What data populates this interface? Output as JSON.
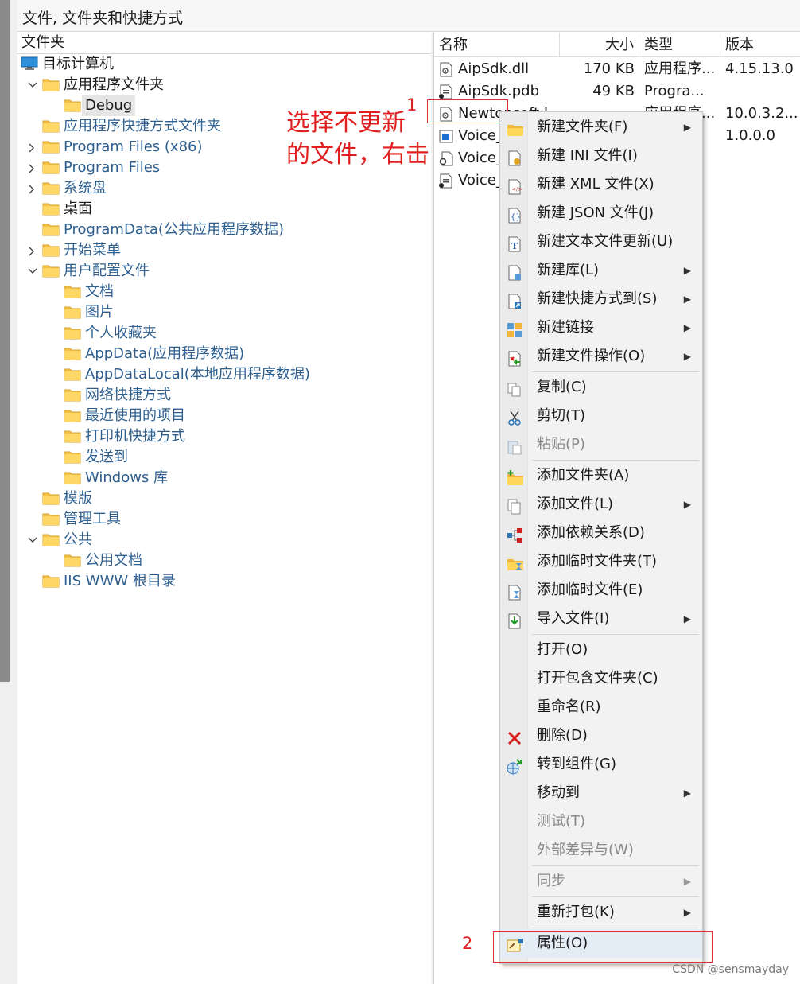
{
  "window": {
    "title": "文件, 文件夹和快捷方式"
  },
  "tree": {
    "header": "文件夹",
    "items": [
      {
        "label": "目标计算机",
        "icon": "monitor-icon",
        "expander": "none",
        "dim": false
      },
      {
        "label": "应用程序文件夹",
        "icon": "folder-icon",
        "expander": "expanded",
        "dim": false
      },
      {
        "label": "Debug",
        "icon": "folder-icon",
        "expander": "none",
        "dim": false,
        "selected": true
      },
      {
        "label": "应用程序快捷方式文件夹",
        "icon": "folder-icon",
        "expander": "none",
        "dim": true
      },
      {
        "label": "Program Files (x86)",
        "icon": "folder-icon",
        "expander": "collapsed",
        "dim": true
      },
      {
        "label": "Program Files",
        "icon": "folder-icon",
        "expander": "collapsed",
        "dim": true
      },
      {
        "label": "系统盘",
        "icon": "folder-icon",
        "expander": "collapsed",
        "dim": true
      },
      {
        "label": "桌面",
        "icon": "folder-icon",
        "expander": "none",
        "dim": false
      },
      {
        "label": "ProgramData(公共应用程序数据)",
        "icon": "folder-icon",
        "expander": "none",
        "dim": true
      },
      {
        "label": "开始菜单",
        "icon": "folder-icon",
        "expander": "collapsed",
        "dim": true
      },
      {
        "label": "用户配置文件",
        "icon": "folder-icon",
        "expander": "expanded",
        "dim": true
      },
      {
        "label": "文档",
        "icon": "folder-icon",
        "expander": "none",
        "dim": true
      },
      {
        "label": "图片",
        "icon": "folder-icon",
        "expander": "none",
        "dim": true
      },
      {
        "label": "个人收藏夹",
        "icon": "folder-icon",
        "expander": "none",
        "dim": true
      },
      {
        "label": "AppData(应用程序数据)",
        "icon": "folder-icon",
        "expander": "none",
        "dim": true
      },
      {
        "label": "AppDataLocal(本地应用程序数据)",
        "icon": "folder-icon",
        "expander": "none",
        "dim": true
      },
      {
        "label": "网络快捷方式",
        "icon": "folder-icon",
        "expander": "none",
        "dim": true
      },
      {
        "label": "最近使用的项目",
        "icon": "folder-icon",
        "expander": "none",
        "dim": true
      },
      {
        "label": "打印机快捷方式",
        "icon": "folder-icon",
        "expander": "none",
        "dim": true
      },
      {
        "label": "发送到",
        "icon": "folder-icon",
        "expander": "none",
        "dim": true
      },
      {
        "label": "Windows 库",
        "icon": "folder-icon",
        "expander": "none",
        "dim": true
      },
      {
        "label": "模版",
        "icon": "folder-icon",
        "expander": "none",
        "dim": true
      },
      {
        "label": "管理工具",
        "icon": "folder-icon",
        "expander": "none",
        "dim": true
      },
      {
        "label": "公共",
        "icon": "folder-icon",
        "expander": "expanded",
        "dim": true
      },
      {
        "label": "公用文档",
        "icon": "folder-icon",
        "expander": "none",
        "dim": true
      },
      {
        "label": "IIS WWW 根目录",
        "icon": "folder-icon",
        "expander": "none",
        "dim": true
      }
    ]
  },
  "files": {
    "columns": {
      "name": "名称",
      "size": "大小",
      "type": "类型",
      "version": "版本"
    },
    "rows": [
      {
        "name": "AipSdk.dll",
        "size": "170 KB",
        "type": "应用程序...",
        "version": "4.15.13.0",
        "icon": "dll-file-icon"
      },
      {
        "name": "AipSdk.pdb",
        "size": "49 KB",
        "type": "Progra...",
        "version": "",
        "icon": "pdb-file-icon"
      },
      {
        "name": "Newtonsoft.J",
        "size": "",
        "type": "应用程序...",
        "version": "10.0.3.2...",
        "icon": "dll-file-icon"
      },
      {
        "name": "Voice_",
        "size": "",
        "type": "",
        "version": "1.0.0.0",
        "icon": "exe-file-icon"
      },
      {
        "name": "Voice_",
        "size": "",
        "type": "...",
        "version": "",
        "icon": "config-file-icon"
      },
      {
        "name": "Voice_",
        "size": "",
        "type": "",
        "version": "",
        "icon": "pdb-file-icon"
      }
    ]
  },
  "annotations": {
    "instruction_line1": "选择不更新",
    "instruction_line2": "的文件，右击",
    "step1": "1",
    "step2": "2"
  },
  "context_menu": {
    "items": [
      {
        "label": "新建文件夹(F)",
        "icon": "new-folder-icon",
        "submenu": true,
        "enabled": true
      },
      {
        "label": "新建 INI 文件(I)",
        "icon": "ini-file-icon",
        "submenu": false,
        "enabled": true
      },
      {
        "label": "新建 XML 文件(X)",
        "icon": "xml-file-icon",
        "submenu": false,
        "enabled": true
      },
      {
        "label": "新建 JSON 文件(J)",
        "icon": "json-file-icon",
        "submenu": false,
        "enabled": true
      },
      {
        "label": "新建文本文件更新(U)",
        "icon": "text-file-icon",
        "submenu": false,
        "enabled": true
      },
      {
        "label": "新建库(L)",
        "icon": "library-icon",
        "submenu": true,
        "enabled": true
      },
      {
        "label": "新建快捷方式到(S)",
        "icon": "shortcut-icon",
        "submenu": true,
        "enabled": true
      },
      {
        "label": "新建链接",
        "icon": "link-icon",
        "submenu": true,
        "enabled": true
      },
      {
        "label": "新建文件操作(O)",
        "icon": "file-operation-icon",
        "submenu": true,
        "enabled": true,
        "sep_after": true
      },
      {
        "label": "复制(C)",
        "icon": "copy-icon",
        "submenu": false,
        "enabled": true
      },
      {
        "label": "剪切(T)",
        "icon": "scissors-icon",
        "submenu": false,
        "enabled": true
      },
      {
        "label": "粘贴(P)",
        "icon": "paste-icon",
        "submenu": false,
        "enabled": false,
        "sep_after": true
      },
      {
        "label": "添加文件夹(A)",
        "icon": "add-folder-icon",
        "submenu": false,
        "enabled": true
      },
      {
        "label": "添加文件(L)",
        "icon": "add-file-icon",
        "submenu": true,
        "enabled": true
      },
      {
        "label": "添加依赖关系(D)",
        "icon": "dependency-icon",
        "submenu": false,
        "enabled": true
      },
      {
        "label": "添加临时文件夹(T)",
        "icon": "temp-folder-icon",
        "submenu": false,
        "enabled": true
      },
      {
        "label": "添加临时文件(E)",
        "icon": "temp-file-icon",
        "submenu": false,
        "enabled": true
      },
      {
        "label": "导入文件(I)",
        "icon": "import-file-icon",
        "submenu": true,
        "enabled": true,
        "sep_after": true
      },
      {
        "label": "打开(O)",
        "icon": "",
        "submenu": false,
        "enabled": true
      },
      {
        "label": "打开包含文件夹(C)",
        "icon": "",
        "submenu": false,
        "enabled": true
      },
      {
        "label": "重命名(R)",
        "icon": "",
        "submenu": false,
        "enabled": true
      },
      {
        "label": "删除(D)",
        "icon": "delete-x-icon",
        "submenu": false,
        "enabled": true
      },
      {
        "label": "转到组件(G)",
        "icon": "component-globe-icon",
        "submenu": false,
        "enabled": true
      },
      {
        "label": "移动到",
        "icon": "",
        "submenu": true,
        "enabled": true
      },
      {
        "label": "测试(T)",
        "icon": "",
        "submenu": false,
        "enabled": false
      },
      {
        "label": "外部差异与(W)",
        "icon": "",
        "submenu": false,
        "enabled": false,
        "sep_after": true
      },
      {
        "label": "同步",
        "icon": "",
        "submenu": true,
        "enabled": false,
        "sep_after": true
      },
      {
        "label": "重新打包(K)",
        "icon": "",
        "submenu": true,
        "enabled": true,
        "sep_after": true
      },
      {
        "label": "属性(O)",
        "icon": "properties-icon",
        "submenu": false,
        "enabled": true,
        "highlighted": true
      }
    ]
  },
  "watermark": "CSDN @sensmayday"
}
